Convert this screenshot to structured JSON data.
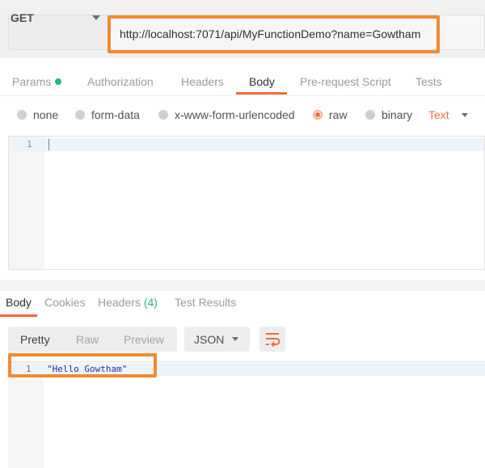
{
  "request": {
    "method": "GET",
    "url": "http://localhost:7071/api/MyFunctionDemo?name=Gowtham"
  },
  "request_tabs": {
    "params": "Params",
    "authorization": "Authorization",
    "headers": "Headers",
    "body": "Body",
    "prerequest": "Pre-request Script",
    "tests": "Tests"
  },
  "body_types": {
    "none": "none",
    "form_data": "form-data",
    "urlencoded": "x-www-form-urlencoded",
    "raw": "raw",
    "binary": "binary",
    "selected": "raw",
    "content_type": "Text"
  },
  "request_editor": {
    "line_number": "1"
  },
  "response_tabs": {
    "body": "Body",
    "cookies": "Cookies",
    "headers": "Headers",
    "headers_count": "(4)",
    "test_results": "Test Results"
  },
  "response_toolbar": {
    "pretty": "Pretty",
    "raw": "Raw",
    "preview": "Preview",
    "format": "JSON",
    "wrap_icon": "wrap-lines-icon"
  },
  "response_editor": {
    "line_number": "1",
    "value": "\"Hello Gowtham\""
  },
  "colors": {
    "accent": "#f26b3a",
    "highlight_box": "#f28a2e",
    "status_green": "#26b47f"
  }
}
